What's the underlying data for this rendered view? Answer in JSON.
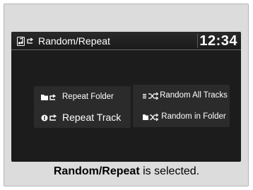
{
  "screen": {
    "title": "Random/Repeat",
    "clock": "12:34",
    "mode_icon": "music-note-repeat-icon"
  },
  "options": [
    {
      "label": "Repeat Folder",
      "icon": "folder-repeat-icon"
    },
    {
      "label": "Random All Tracks",
      "icon": "shuffle-all-icon"
    },
    {
      "label": "Repeat Track",
      "icon": "single-track-repeat-icon"
    },
    {
      "label": "Random in Folder",
      "icon": "folder-shuffle-icon"
    }
  ],
  "caption": {
    "bold": "Random/Repeat",
    "rest": " is selected."
  },
  "colors": {
    "screen_bg": "#1c1c1c",
    "button_bg": "#2b2b2b",
    "frame_bg": "#dcdcdc",
    "text": "#ffffff"
  }
}
